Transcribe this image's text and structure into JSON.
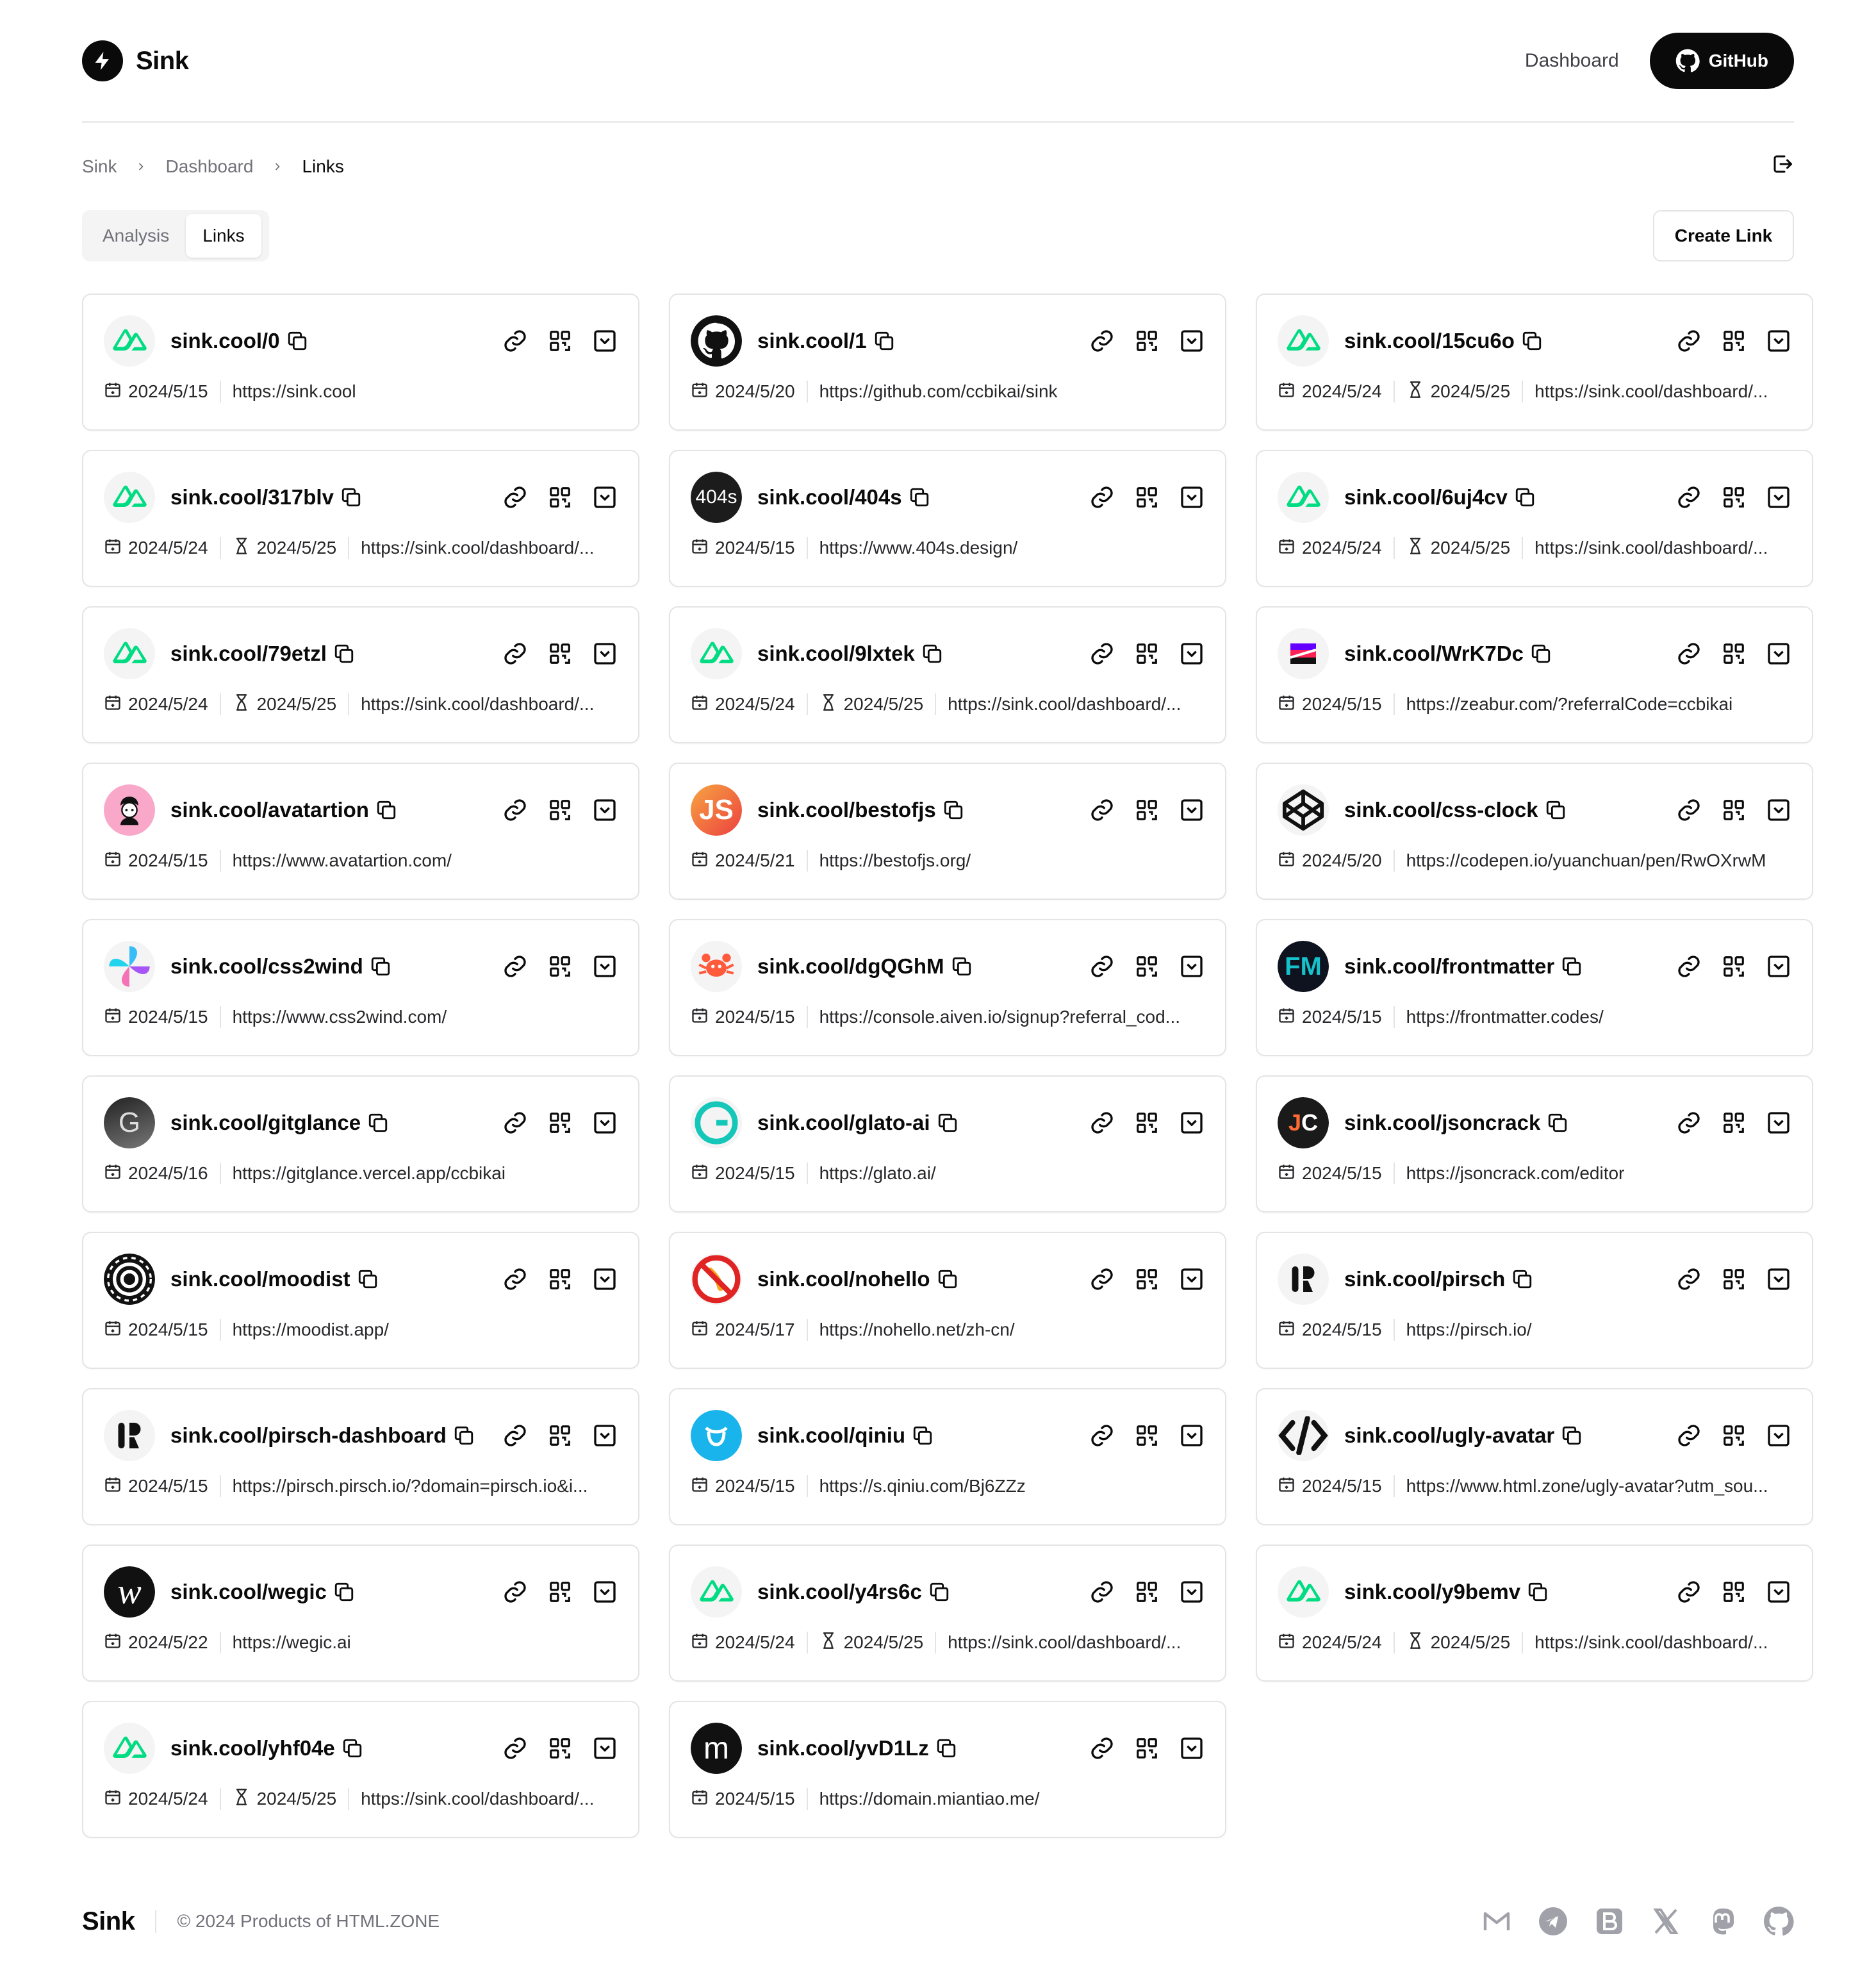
{
  "header": {
    "brand": "Sink",
    "dashboard_link": "Dashboard",
    "github_button": "GitHub"
  },
  "breadcrumb": [
    "Sink",
    "Dashboard",
    "Links"
  ],
  "tabs": [
    {
      "label": "Analysis"
    },
    {
      "label": "Links",
      "active": true
    }
  ],
  "create_link": "Create Link",
  "links": [
    {
      "slug": "sink.cool/0",
      "created": "2024/5/15",
      "expires": "",
      "url": "https://sink.cool",
      "favicon": "nuxt"
    },
    {
      "slug": "sink.cool/1",
      "created": "2024/5/20",
      "expires": "",
      "url": "https://github.com/ccbikai/sink",
      "favicon": "github"
    },
    {
      "slug": "sink.cool/15cu6o",
      "created": "2024/5/24",
      "expires": "2024/5/25",
      "url": "https://sink.cool/dashboard/...",
      "favicon": "nuxt"
    },
    {
      "slug": "sink.cool/317blv",
      "created": "2024/5/24",
      "expires": "2024/5/25",
      "url": "https://sink.cool/dashboard/...",
      "favicon": "nuxt"
    },
    {
      "slug": "sink.cool/404s",
      "created": "2024/5/15",
      "expires": "",
      "url": "https://www.404s.design/",
      "favicon": "404s"
    },
    {
      "slug": "sink.cool/6uj4cv",
      "created": "2024/5/24",
      "expires": "2024/5/25",
      "url": "https://sink.cool/dashboard/...",
      "favicon": "nuxt"
    },
    {
      "slug": "sink.cool/79etzl",
      "created": "2024/5/24",
      "expires": "2024/5/25",
      "url": "https://sink.cool/dashboard/...",
      "favicon": "nuxt"
    },
    {
      "slug": "sink.cool/9lxtek",
      "created": "2024/5/24",
      "expires": "2024/5/25",
      "url": "https://sink.cool/dashboard/...",
      "favicon": "nuxt"
    },
    {
      "slug": "sink.cool/WrK7Dc",
      "created": "2024/5/15",
      "expires": "",
      "url": "https://zeabur.com/?referralCode=ccbikai",
      "favicon": "zeabur"
    },
    {
      "slug": "sink.cool/avatartion",
      "created": "2024/5/15",
      "expires": "",
      "url": "https://www.avatartion.com/",
      "favicon": "avatartion"
    },
    {
      "slug": "sink.cool/bestofjs",
      "created": "2024/5/21",
      "expires": "",
      "url": "https://bestofjs.org/",
      "favicon": "bestofjs"
    },
    {
      "slug": "sink.cool/css-clock",
      "created": "2024/5/20",
      "expires": "",
      "url": "https://codepen.io/yuanchuan/pen/RwOXrwM",
      "favicon": "codepen"
    },
    {
      "slug": "sink.cool/css2wind",
      "created": "2024/5/15",
      "expires": "",
      "url": "https://www.css2wind.com/",
      "favicon": "css2wind"
    },
    {
      "slug": "sink.cool/dgQGhM",
      "created": "2024/5/15",
      "expires": "",
      "url": "https://console.aiven.io/signup?referral_cod...",
      "favicon": "aiven"
    },
    {
      "slug": "sink.cool/frontmatter",
      "created": "2024/5/15",
      "expires": "",
      "url": "https://frontmatter.codes/",
      "favicon": "frontmatter"
    },
    {
      "slug": "sink.cool/gitglance",
      "created": "2024/5/16",
      "expires": "",
      "url": "https://gitglance.vercel.app/ccbikai",
      "favicon": "gitglance"
    },
    {
      "slug": "sink.cool/glato-ai",
      "created": "2024/5/15",
      "expires": "",
      "url": "https://glato.ai/",
      "favicon": "glato"
    },
    {
      "slug": "sink.cool/jsoncrack",
      "created": "2024/5/15",
      "expires": "",
      "url": "https://jsoncrack.com/editor",
      "favicon": "jsoncrack"
    },
    {
      "slug": "sink.cool/moodist",
      "created": "2024/5/15",
      "expires": "",
      "url": "https://moodist.app/",
      "favicon": "moodist"
    },
    {
      "slug": "sink.cool/nohello",
      "created": "2024/5/17",
      "expires": "",
      "url": "https://nohello.net/zh-cn/",
      "favicon": "nohello"
    },
    {
      "slug": "sink.cool/pirsch",
      "created": "2024/5/15",
      "expires": "",
      "url": "https://pirsch.io/",
      "favicon": "pirsch"
    },
    {
      "slug": "sink.cool/pirsch-dashboard",
      "created": "2024/5/15",
      "expires": "",
      "url": "https://pirsch.pirsch.io/?domain=pirsch.io&i...",
      "favicon": "pirsch"
    },
    {
      "slug": "sink.cool/qiniu",
      "created": "2024/5/15",
      "expires": "",
      "url": "https://s.qiniu.com/Bj6ZZz",
      "favicon": "qiniu"
    },
    {
      "slug": "sink.cool/ugly-avatar",
      "created": "2024/5/15",
      "expires": "",
      "url": "https://www.html.zone/ugly-avatar?utm_sou...",
      "favicon": "htmlzone"
    },
    {
      "slug": "sink.cool/wegic",
      "created": "2024/5/22",
      "expires": "",
      "url": "https://wegic.ai",
      "favicon": "wegic"
    },
    {
      "slug": "sink.cool/y4rs6c",
      "created": "2024/5/24",
      "expires": "2024/5/25",
      "url": "https://sink.cool/dashboard/...",
      "favicon": "nuxt"
    },
    {
      "slug": "sink.cool/y9bemv",
      "created": "2024/5/24",
      "expires": "2024/5/25",
      "url": "https://sink.cool/dashboard/...",
      "favicon": "nuxt"
    },
    {
      "slug": "sink.cool/yhf04e",
      "created": "2024/5/24",
      "expires": "2024/5/25",
      "url": "https://sink.cool/dashboard/...",
      "favicon": "nuxt"
    },
    {
      "slug": "sink.cool/yvD1Lz",
      "created": "2024/5/15",
      "expires": "",
      "url": "https://domain.miantiao.me/",
      "favicon": "miantiao"
    }
  ],
  "footer": {
    "brand": "Sink",
    "copyright": "© 2024 Products of HTML.ZONE",
    "social": [
      "mail-icon",
      "telegram-icon",
      "blog-icon",
      "x-icon",
      "mastodon-icon",
      "github-icon"
    ]
  },
  "colors": {
    "accent": "#0a0a0a",
    "nuxt_green": "#00dc82",
    "border": "#e4e4e7",
    "muted": "#71717a"
  }
}
